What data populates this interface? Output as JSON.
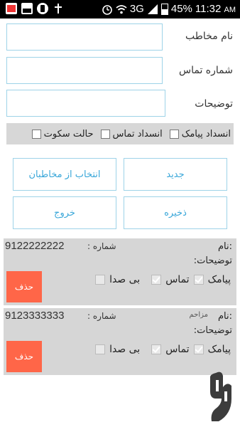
{
  "status_bar": {
    "network": "3G",
    "battery": "45%",
    "time": "11:32",
    "ampm": "AM",
    "battery_level": 0.45
  },
  "form": {
    "contact_name_label": "نام مخاطب",
    "contact_number_label": "شماره تماس",
    "description_label": "توضیحات",
    "checks": {
      "block_sms": "انسداد پیامک",
      "block_call": "انسداد تماس",
      "silent_mode": "حالت سکوت"
    }
  },
  "buttons": {
    "new": "جدید",
    "choose_contacts": "انتخاب از مخاطبان",
    "save": "ذخیره",
    "exit": "خروج"
  },
  "contacts": [
    {
      "name_label": "نام:",
      "name_value": "",
      "number_label": "شماره :",
      "number_value": "9122222222",
      "description_label": "توضیحات:",
      "sms_label": "پیامک",
      "call_label": "تماس",
      "mute_label": "بی صدا",
      "delete_label": "حذف"
    },
    {
      "name_label": "نام:",
      "name_value": "مزاحم",
      "number_label": "شماره :",
      "number_value": "9123333333",
      "description_label": "توضیحات:",
      "sms_label": "پیامک",
      "call_label": "تماس",
      "mute_label": "بی صدا",
      "delete_label": "حذف"
    }
  ],
  "colors": {
    "accent": "#3aa7d9",
    "field_border": "#9ed3e8",
    "card_bg": "#d6d6d6",
    "delete_bg": "#ff6648"
  }
}
